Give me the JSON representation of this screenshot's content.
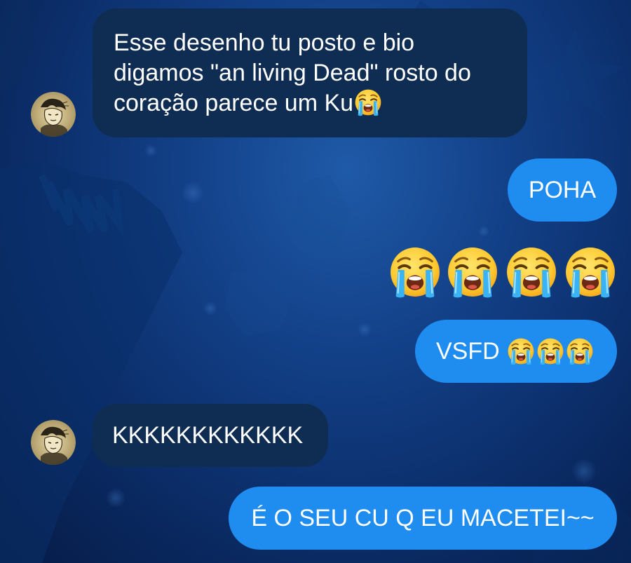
{
  "chat": {
    "background_colors": {
      "top": "#1f5aa8",
      "bottom": "#061b45"
    },
    "incoming_bubble_color": "#0f2d52",
    "outgoing_bubble_color": "#1f8cf0",
    "messages": [
      {
        "direction": "incoming",
        "line1": "Esse desenho tu posto e bio",
        "line2": "digamos \"an living Dead\" rosto do",
        "line3": "coração parece um Ku",
        "trailing_emoji": "loudly-crying-face-emoji"
      },
      {
        "direction": "outgoing",
        "text": "POHA"
      },
      {
        "direction": "outgoing",
        "emoji_only": "loudly-crying-face-emoji x4"
      },
      {
        "direction": "outgoing",
        "text": "VSFD",
        "trailing_emoji": "loudly-crying-face-emoji x3"
      },
      {
        "direction": "incoming",
        "text": "KKKKKKKKKKKK"
      },
      {
        "direction": "outgoing",
        "text": "É O SEU CU Q EU MACETEI~~"
      }
    ],
    "avatar": {
      "icon": "sketch-portrait-avatar"
    }
  }
}
